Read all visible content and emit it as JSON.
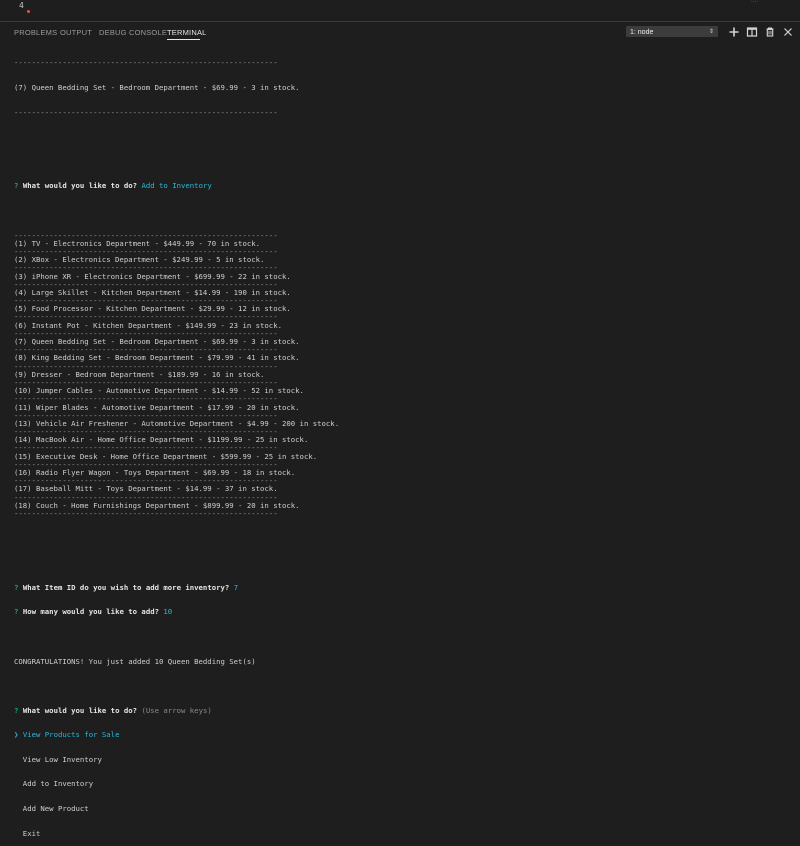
{
  "editor": {
    "line_number": "4",
    "minimap_text": "ᵗᵉˣᵗ"
  },
  "panel": {
    "tabs": [
      {
        "label": "PROBLEMS"
      },
      {
        "label": "OUTPUT"
      },
      {
        "label": "DEBUG CONSOLE"
      },
      {
        "label": "TERMINAL"
      }
    ],
    "terminal_selector": "1: node",
    "icons": [
      "plus-icon",
      "split-icon",
      "trash-icon",
      "chevron-up-icon",
      "close-icon"
    ]
  },
  "terminal": {
    "separator": "------------------------------------------------------------",
    "top_item": "(7) Queen Bedding Set - Bedroom Department - $69.99 - 3 in stock.",
    "prompt1": {
      "mark": "?",
      "question": "What would you like to do?",
      "answer": "Add to Inventory"
    },
    "items": [
      "(1) TV - Electronics Department - $449.99 - 70 in stock.",
      "(2) XBox - Electronics Department - $249.99 - 5 in stock.",
      "(3) iPhone XR - Electronics Department - $699.99 - 22 in stock.",
      "(4) Large Skillet - Kitchen Department - $14.99 - 190 in stock.",
      "(5) Food Processor - Kitchen Department - $29.99 - 12 in stock.",
      "(6) Instant Pot - Kitchen Department - $149.99 - 23 in stock.",
      "(7) Queen Bedding Set - Bedroom Department - $69.99 - 3 in stock.",
      "(8) King Bedding Set - Bedroom Department - $79.99 - 41 in stock.",
      "(9) Dresser - Bedroom Department - $189.99 - 16 in stock.",
      "(10) Jumper Cables - Automotive Department - $14.99 - 52 in stock.",
      "(11) Wiper Blades - Automotive Department - $17.99 - 20 in stock.",
      "(13) Vehicle Air Freshener - Automotive Department - $4.99 - 200 in stock.",
      "(14) MacBook Air - Home Office Department - $1199.99 - 25 in stock.",
      "(15) Executive Desk - Home Office Department - $599.99 - 25 in stock.",
      "(16) Radio Flyer Wagon - Toys Department - $69.99 - 18 in stock.",
      "(17) Baseball Mitt - Toys Department - $14.99 - 37 in stock.",
      "(18) Couch - Home Furnishings Department - $899.99 - 20 in stock."
    ],
    "prompt2": {
      "mark": "?",
      "question": "What Item ID do you wish to add more inventory?",
      "answer": "7"
    },
    "prompt3": {
      "mark": "?",
      "question": "How many would you like to add?",
      "answer": "10"
    },
    "congrats": "CONGRATULATIONS! You just added 10 Queen Bedding Set(s)",
    "prompt4": {
      "mark": "?",
      "question": "What would you like to do?",
      "hint": "(Use arrow keys)"
    },
    "menu": {
      "pointer": "❯",
      "selected": "View Products for Sale",
      "options": [
        "View Low Inventory",
        "Add to Inventory",
        "Add New Product",
        "Exit"
      ]
    }
  },
  "colors": {
    "background": "#1e1e1e",
    "prompt_mark": "#23d18b",
    "answer": "#29b8db"
  }
}
